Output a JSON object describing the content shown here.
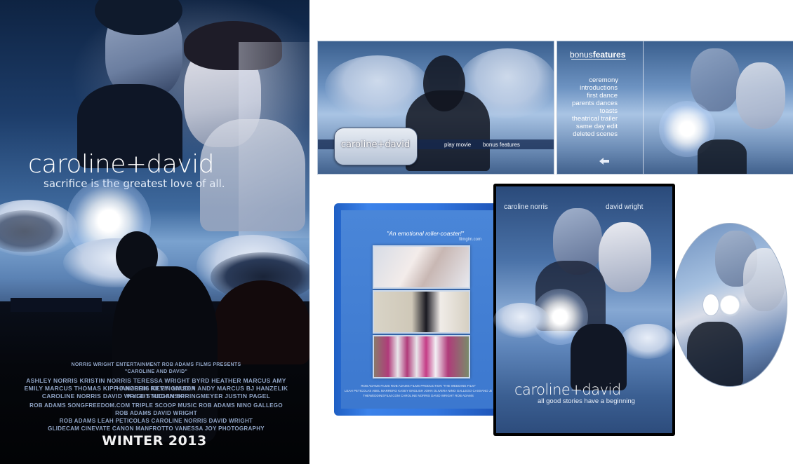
{
  "poster": {
    "title": "caroline+david",
    "tagline": "sacrifice is the greatest love of all.",
    "presents_line": "NORRIS WRIGHT ENTERTAINMENT  ROB ADAMS FILMS PRESENTS",
    "film_title": "\"CAROLINE AND DAVID\"",
    "cast_line_1": "ASHLEY NORRIS  KRISTIN NORRIS  TERESSA WRIGHT BYRD  HEATHER MARCUS  AMY HANZELIK  RILEY GAUDIA",
    "cast_line_2": "EMILY MARCUS  THOMAS KIPP  J NORRIS  KEVIN MASON  ANDY MARCUS  BJ HANZELIK  KYLE STUCHINSKI",
    "cast_line_3": "CAROLINE NORRIS  DAVID WRIGHT  MEGAN SPRINGMEYER  JUSTIN PAGEL",
    "credit_line_1": "ROB ADAMS  SONGFREEDOM.COM  TRIPLE SCOOP MUSIC  ROB ADAMS  NINO GALLEGO",
    "credit_line_2": "ROB ADAMS  DAVID WRIGHT",
    "credit_line_3": "ROB ADAMS  LEAH PETICOLAS  CAROLINE NORRIS  DAVID WRIGHT",
    "credit_line_4": "GLIDECAM  CINEVATE  CANON  MANFROTTO  VANESSA JOY PHOTOGRAPHY",
    "release": "WINTER 2013"
  },
  "menu_main": {
    "logo": "caroline+david",
    "play_movie": "play movie",
    "bonus_features": "bonus features"
  },
  "menu_bonus": {
    "heading_prefix": "bonus",
    "heading_suffix": "features",
    "items": [
      "ceremony",
      "introductions",
      "first dance",
      "parents dances",
      "toasts",
      "theatrical trailer",
      "same day edit",
      "deleted scenes"
    ],
    "back_icon": "back-arrow-icon"
  },
  "case_back": {
    "quote": "\"An emotional roller-coaster!\"",
    "quote_source": "filmglm.com",
    "credits_1": "ROB ADAMS FILMS  ROB ADAMS FILMS PRODUCTION \"THE WEDDING FILM\"",
    "credits_2": "LEAH PETICOLAS  ABEL MARRERO  KASEY ENGLISH  JOHN OLIVERA  NINO GALLEGO  CASSANO  JESSICA GOLDSMITH",
    "credits_3": "THEWEDDINGFILM.COM  CAROLINE NORRIS  DAVID WRIGHT  ROB ADAMS"
  },
  "case_front": {
    "name_left": "caroline norris",
    "name_right": "david wright",
    "title": "caroline+david",
    "tagline": "all good stories have a beginning"
  },
  "colors": {
    "case_blue": "#2f74dc",
    "poster_text": "#ffffff",
    "menu_text": "#ffffff"
  }
}
